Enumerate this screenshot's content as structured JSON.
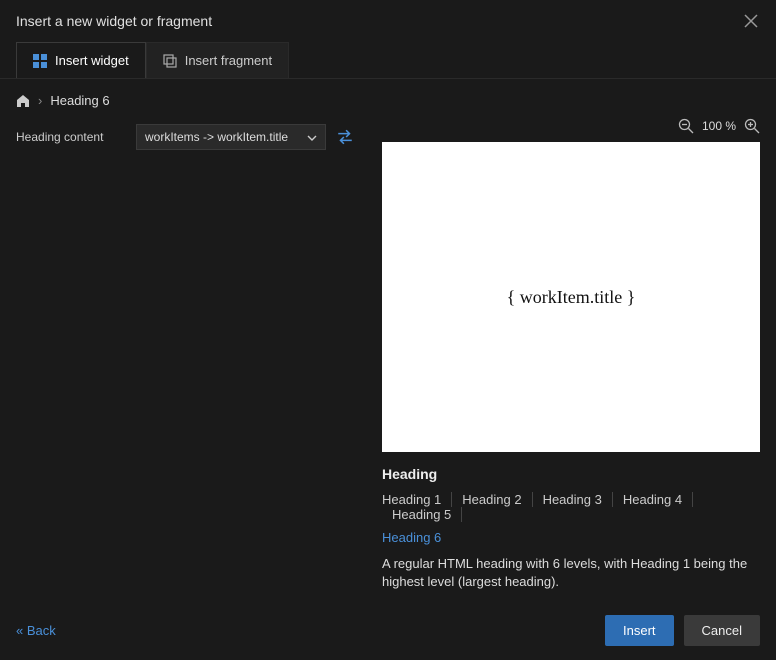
{
  "dialog": {
    "title": "Insert a new widget or fragment"
  },
  "tabs": {
    "widget": "Insert widget",
    "fragment": "Insert fragment"
  },
  "breadcrumb": {
    "current": "Heading 6"
  },
  "form": {
    "heading_content_label": "Heading content",
    "heading_content_value": "workItems -> workItem.title"
  },
  "zoom": {
    "value": "100 %"
  },
  "preview": {
    "text": "{ workItem.title }"
  },
  "info": {
    "title": "Heading",
    "headings": [
      "Heading 1",
      "Heading 2",
      "Heading 3",
      "Heading 4",
      "Heading 5",
      "Heading 6"
    ],
    "active_index": 5,
    "description": "A regular HTML heading with 6 levels, with Heading 1 being the highest level (largest heading)."
  },
  "footer": {
    "back": "« Back",
    "insert": "Insert",
    "cancel": "Cancel"
  }
}
